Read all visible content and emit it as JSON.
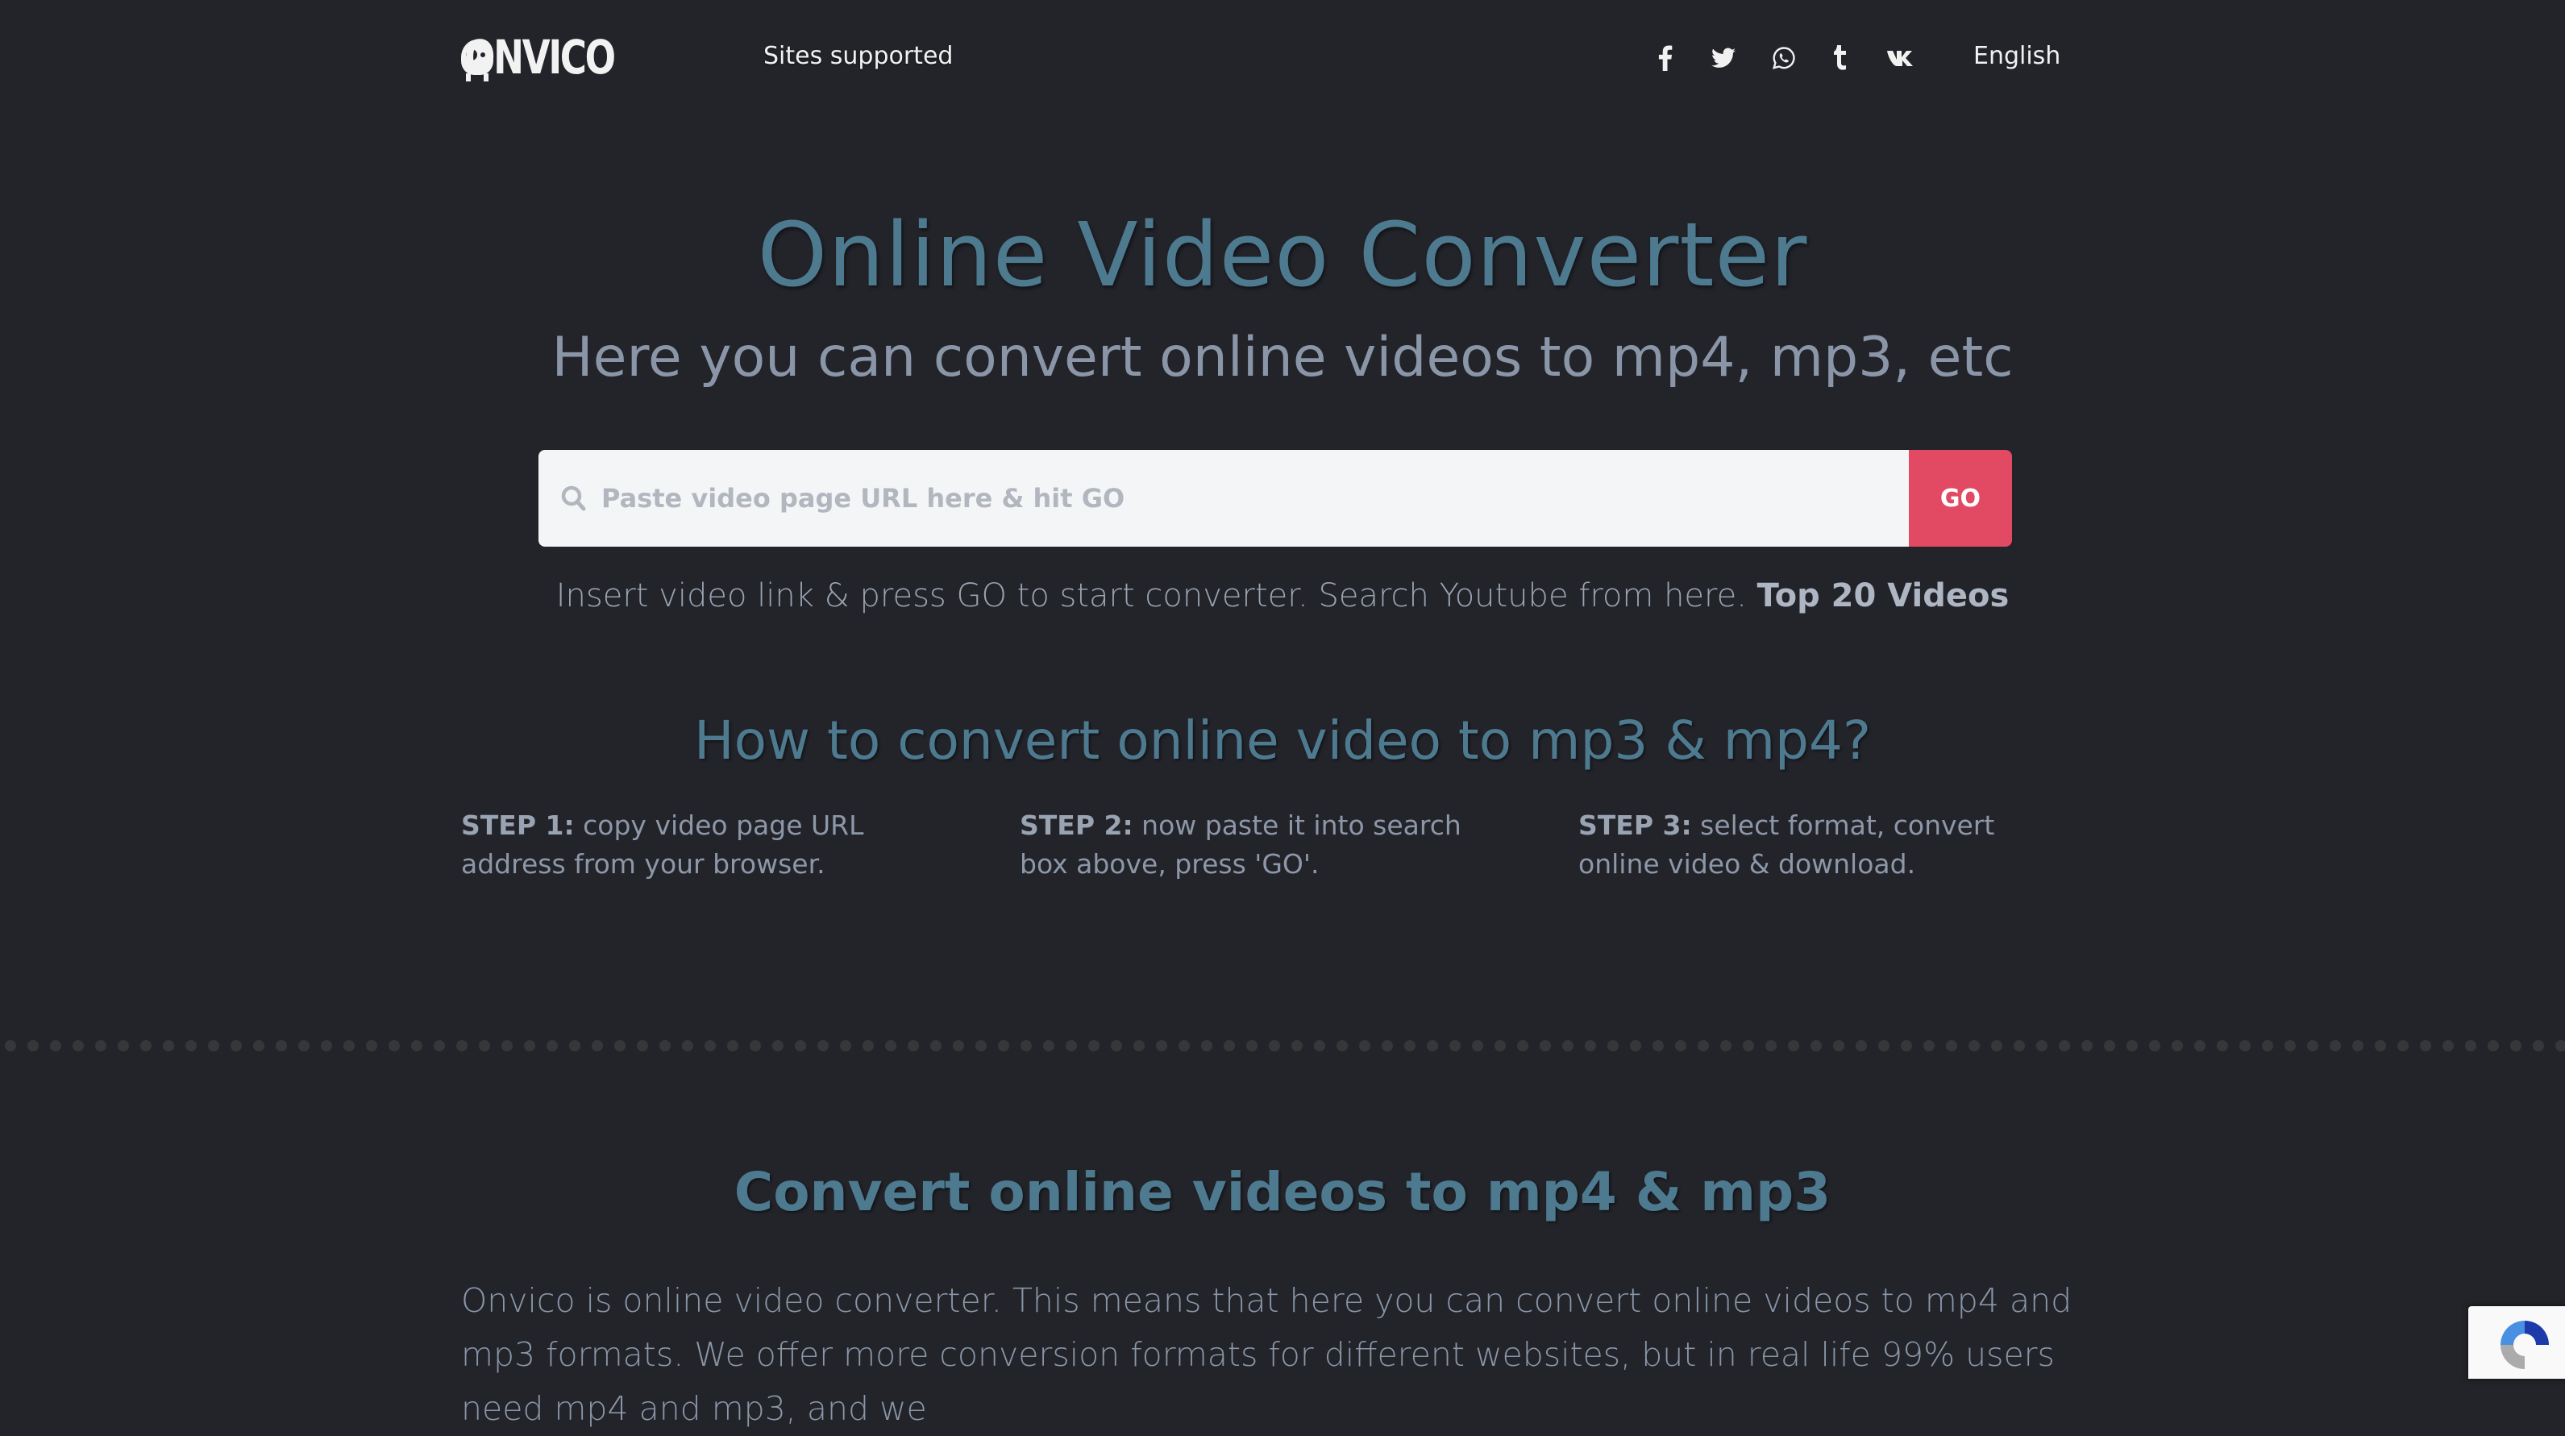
{
  "header": {
    "logo_text": "ONVICO",
    "nav_sites_supported": "Sites supported",
    "social_icons": [
      "facebook-icon",
      "twitter-icon",
      "whatsapp-icon",
      "tumblr-icon",
      "vk-icon"
    ],
    "language": "English"
  },
  "hero": {
    "title": "Online Video Converter",
    "subtitle": "Here you can convert online videos to mp4, mp3, etc",
    "search": {
      "placeholder": "Paste video page URL here & hit GO",
      "value": "",
      "go_label": "GO"
    },
    "hint_text": "Insert video link & press GO to start converter. Search Youtube from here.",
    "hint_link": "Top 20 Videos"
  },
  "how_to": {
    "heading": "How to convert online video to mp3 & mp4?",
    "steps": [
      {
        "label": "STEP 1:",
        "text": "copy video page URL address from your browser."
      },
      {
        "label": "STEP 2:",
        "text": "now paste it into search box above, press 'GO'."
      },
      {
        "label": "STEP 3:",
        "text": "select format, convert online video & download."
      }
    ]
  },
  "about": {
    "heading": "Convert online videos to mp4 & mp3",
    "paragraph": "Onvico is online video converter. This means that here you can convert online videos to mp4 and mp3 formats. We offer more conversion formats for different websites, but in real life 99% users need mp4 and mp3, and we"
  },
  "colors": {
    "background": "#22242a",
    "accent_title": "#4e7a90",
    "go_button": "#e24a64",
    "search_bg": "#f4f5f7"
  }
}
